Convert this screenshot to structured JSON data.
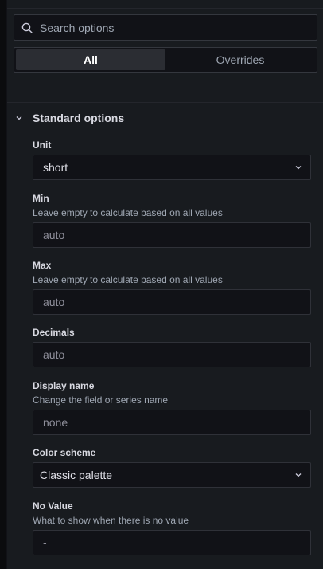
{
  "search": {
    "placeholder": "Search options"
  },
  "tabs": [
    {
      "label": "All",
      "active": true
    },
    {
      "label": "Overrides",
      "active": false
    }
  ],
  "section": {
    "title": "Standard options"
  },
  "fields": {
    "unit": {
      "label": "Unit",
      "value": "short"
    },
    "min": {
      "label": "Min",
      "description": "Leave empty to calculate based on all values",
      "placeholder": "auto"
    },
    "max": {
      "label": "Max",
      "description": "Leave empty to calculate based on all values",
      "placeholder": "auto"
    },
    "decimals": {
      "label": "Decimals",
      "placeholder": "auto"
    },
    "display_name": {
      "label": "Display name",
      "description": "Change the field or series name",
      "placeholder": "none"
    },
    "color_scheme": {
      "label": "Color scheme",
      "value": "Classic palette"
    },
    "no_value": {
      "label": "No Value",
      "description": "What to show when there is no value",
      "placeholder": "-"
    }
  },
  "icons": {
    "search": "search-icon",
    "section_toggle": "chevron-down-icon",
    "select_caret": "chevron-down-icon"
  },
  "colors": {
    "background": "#181b1f",
    "input_background": "#111217",
    "border": "#2f3138",
    "active_tab": "#2b2d33"
  }
}
